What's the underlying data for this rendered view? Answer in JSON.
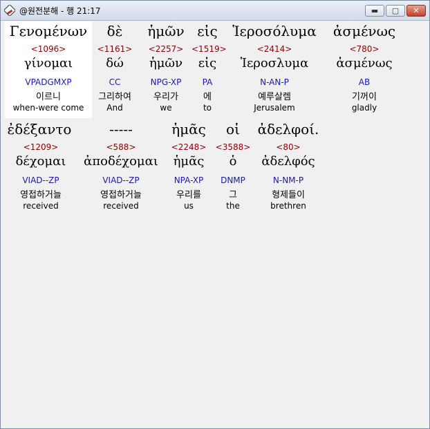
{
  "window": {
    "title": "@원전분해 - 행 21:17",
    "controls": {
      "minimize": "▬",
      "maximize": "▢",
      "close": "✕"
    }
  },
  "lines": [
    {
      "words": [
        {
          "greek": "Γενομένων",
          "strong": "<1096>",
          "lemma": "γίνομαι",
          "parse": "VPADGMXP",
          "korean": "이르니",
          "english": "when-were come"
        },
        {
          "greek": "δὲ",
          "strong": "<1161>",
          "lemma": "δώ",
          "parse": "CC",
          "korean": "그리하여",
          "english": "And"
        },
        {
          "greek": "ἡμῶν",
          "strong": "<2257>",
          "lemma": "ἡμῶν",
          "parse": "NPG-XP",
          "korean": "우리가",
          "english": "we"
        },
        {
          "greek": "εἰς",
          "strong": "<1519>",
          "lemma": "εἰς",
          "parse": "PA",
          "korean": "에",
          "english": "to"
        },
        {
          "greek": "Ἱεροσόλυμα",
          "strong": "<2414>",
          "lemma": "Ἱεροσλυμα",
          "parse": "N-AN-P",
          "korean": "예루살렘",
          "english": "Jerusalem"
        },
        {
          "greek": "ἀσμένως",
          "strong": "<780>",
          "lemma": "ἀσμένως",
          "parse": "AB",
          "korean": "기꺼이",
          "english": "gladly"
        }
      ]
    },
    {
      "words": [
        {
          "greek": "ἐδέξαντο",
          "strong": "<1209>",
          "lemma": "δέχομαι",
          "parse": "VIAD--ZP",
          "korean": "영접하거늘",
          "english": "received"
        },
        {
          "greek": "-----",
          "strong": "<588>",
          "lemma": "ἀποδέχομαι",
          "parse": "VIAD--ZP",
          "korean": "영접하거늘",
          "english": "received"
        },
        {
          "greek": "ἡμᾶς",
          "strong": "<2248>",
          "lemma": "ἡμᾶς",
          "parse": "NPA-XP",
          "korean": "우리를",
          "english": "us"
        },
        {
          "greek": "οἱ",
          "strong": "<3588>",
          "lemma": "ὁ",
          "parse": "DNMP",
          "korean": "그",
          "english": "the"
        },
        {
          "greek": "ἀδελφοί.",
          "strong": "<80>",
          "lemma": "ἀδελφός",
          "parse": "N-NM-P",
          "korean": "형제들이",
          "english": "brethren"
        }
      ]
    }
  ]
}
